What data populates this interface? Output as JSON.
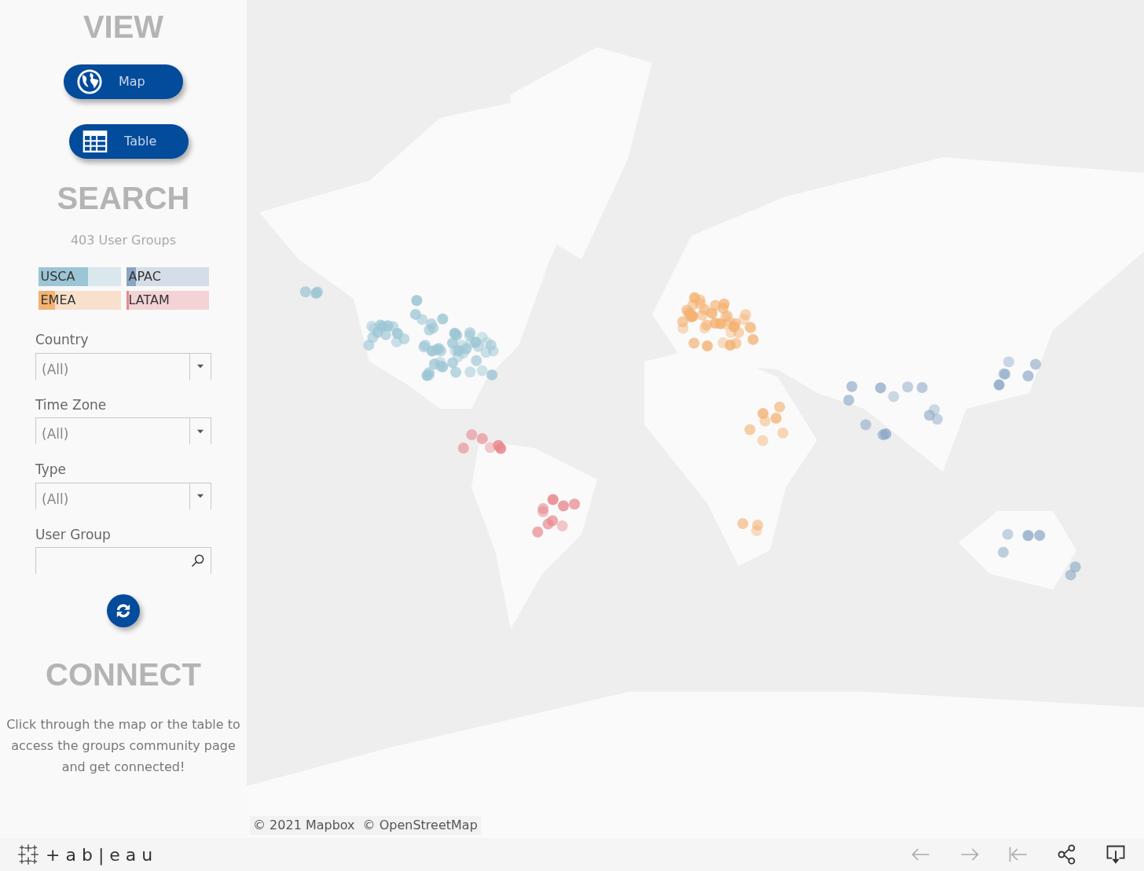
{
  "sidebar": {
    "view_heading": "VIEW",
    "view_buttons": [
      {
        "kind": "map",
        "label": "Map"
      },
      {
        "kind": "table",
        "label": "Table"
      }
    ],
    "search_heading": "SEARCH",
    "group_count": "403 User Groups",
    "regions": [
      {
        "label": "USCA",
        "color": "#9cc6d5",
        "level": 0.6
      },
      {
        "label": "APAC",
        "color": "#8aa6c5",
        "level": 0.12
      },
      {
        "label": "EMEA",
        "color": "#f4b273",
        "level": 0.2
      },
      {
        "label": "LATAM",
        "color": "#e8888e",
        "level": 0.03
      }
    ],
    "filters": [
      {
        "kind": "dropdown",
        "label": "Country",
        "value": "(All)"
      },
      {
        "kind": "dropdown",
        "label": "Time Zone",
        "value": "(All)"
      },
      {
        "kind": "dropdown",
        "label": "Type",
        "value": "(All)"
      },
      {
        "kind": "search",
        "label": "User Group"
      }
    ],
    "connect_heading": "CONNECT",
    "connect_text": "Click through the map or the table  to access the groups community page and get connected!"
  },
  "map": {
    "attributions": [
      "© 2021 Mapbox",
      "© OpenStreetMap"
    ]
  },
  "footer": {
    "logo": "+ab|eau",
    "tools": [
      {
        "kind": "undo",
        "disabled": true
      },
      {
        "kind": "redo",
        "disabled": true
      },
      {
        "kind": "revert",
        "disabled": true
      },
      {
        "kind": "share",
        "disabled": false
      },
      {
        "kind": "download",
        "disabled": false
      }
    ]
  }
}
